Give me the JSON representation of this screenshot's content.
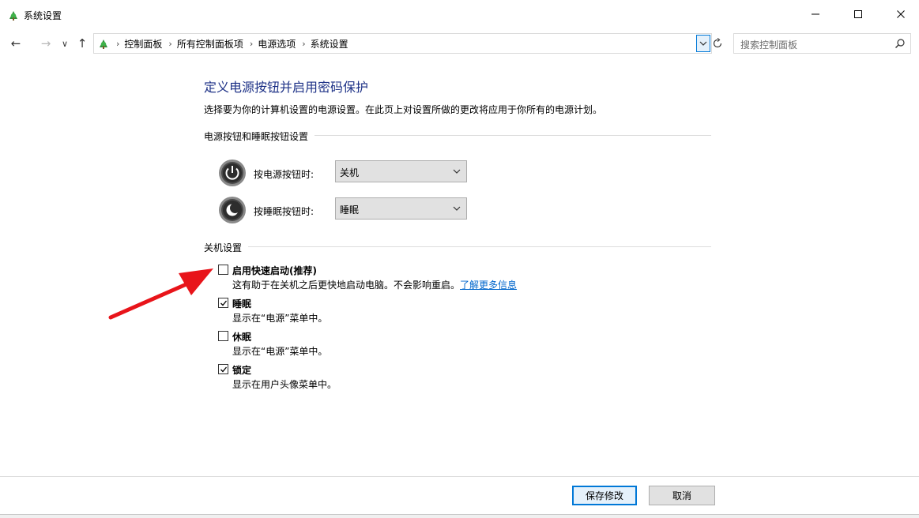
{
  "window": {
    "title": "系统设置",
    "minimize_glyph": "—",
    "maximize_glyph": "☐",
    "close_glyph": "✕"
  },
  "nav": {
    "back_glyph": "←",
    "forward_glyph": "→",
    "recent_glyph": "∨",
    "up_glyph": "↑",
    "breadcrumbs": [
      "控制面板",
      "所有控制面板项",
      "电源选项",
      "系统设置"
    ],
    "search_placeholder": "搜索控制面板"
  },
  "page": {
    "title": "定义电源按钮并启用密码保护",
    "description": "选择要为你的计算机设置的电源设置。在此页上对设置所做的更改将应用于你所有的电源计划。"
  },
  "power_buttons": {
    "group_title": "电源按钮和睡眠按钮设置",
    "power_label": "按电源按钮时:",
    "power_value": "关机",
    "sleep_label": "按睡眠按钮时:",
    "sleep_value": "睡眠"
  },
  "shutdown": {
    "group_title": "关机设置",
    "options": [
      {
        "label": "启用快速启动(推荐)",
        "desc": "这有助于在关机之后更快地启动电脑。不会影响重启。",
        "link": "了解更多信息",
        "checked": false
      },
      {
        "label": "睡眠",
        "desc": "显示在“电源”菜单中。",
        "checked": true
      },
      {
        "label": "休眠",
        "desc": "显示在“电源”菜单中。",
        "checked": false
      },
      {
        "label": "锁定",
        "desc": "显示在用户头像菜单中。",
        "checked": true
      }
    ]
  },
  "footer": {
    "save_label": "保存修改",
    "cancel_label": "取消"
  },
  "colors": {
    "title_blue": "#1e3287",
    "link_blue": "#0066cc",
    "accent": "#0078d7",
    "annotation_red": "#e8141a"
  }
}
